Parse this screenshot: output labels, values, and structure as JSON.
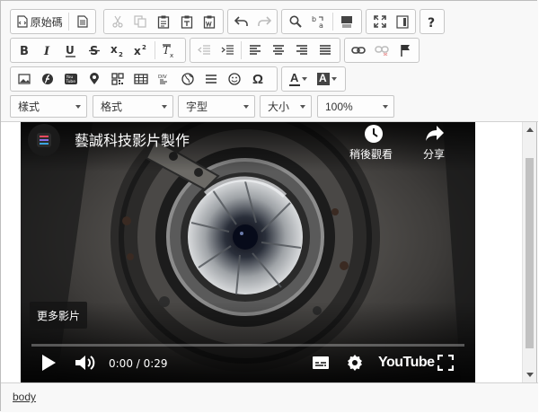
{
  "toolbar": {
    "source_label": "原始碼",
    "font_color_label": "A",
    "bg_color_label": "A",
    "special_char_label": "Ω",
    "combos": {
      "style": "樣式",
      "format": "格式",
      "font": "字型",
      "size": "大小",
      "zoom": "100%"
    }
  },
  "video": {
    "channel_title": "藝誠科技影片製作",
    "watch_later_label": "稍後觀看",
    "share_label": "分享",
    "more_videos_label": "更多影片",
    "time": "0:00 / 0:29",
    "youtube_label": "YouTube",
    "progress": 0
  },
  "statusbar": {
    "path": "body"
  },
  "colors": {
    "toolbar_bg": "#f8f8f8",
    "border": "#c6c6c6",
    "video_bg": "#0c0c0c",
    "accent": "#ffffff"
  }
}
